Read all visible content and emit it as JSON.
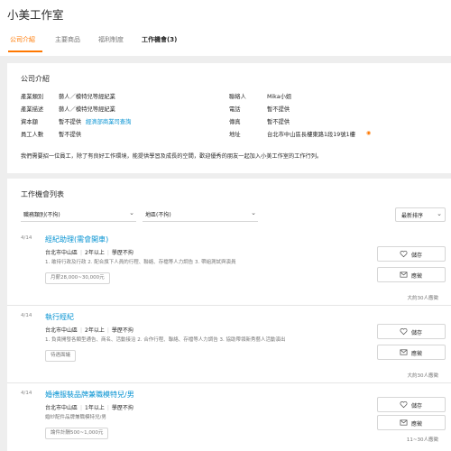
{
  "company": {
    "name": "小美工作室"
  },
  "tabs": [
    {
      "label": "公司介紹"
    },
    {
      "label": "主要商品"
    },
    {
      "label": "福利制度"
    },
    {
      "label": "工作機會(3)"
    }
  ],
  "intro": {
    "title": "公司介紹",
    "fields": {
      "industry_label": "產業類別",
      "industry": "藝人／模特兒等經紀業",
      "industry_desc_label": "產業描述",
      "industry_desc": "藝人／模特兒等經紀業",
      "capital_label": "資本額",
      "capital": "暫不提供",
      "capital_link": "經濟部商業司查詢",
      "employees_label": "員工人數",
      "employees": "暫不提供",
      "contact_label": "聯絡人",
      "contact": "Mika小姐",
      "phone_label": "電話",
      "phone": "暫不提供",
      "fax_label": "傳真",
      "fax": "暫不提供",
      "address_label": "地址",
      "address": "台北市中山區長樓東路1段19號1樓"
    },
    "description": "我們需要招一位員工，除了有良好工作環境，能提供學習及成長的空間，歡迎優秀的朋友一起加入小美工作室的工作行列。"
  },
  "jobs_section": {
    "title": "工作機會列表",
    "filters": {
      "category": "職務類別(不拘)",
      "location": "地區(不拘)"
    },
    "sort": "最新排序"
  },
  "jobs": [
    {
      "date": "4/14",
      "title": "經紀助理(需會開車)",
      "location": "台北市中山區",
      "experience": "2年以上",
      "education": "學歷不拘",
      "description": "1. 敢待行政及行政 2. 配合旗下人員的行程、聯絡、存檔等人力調告 3. 帶組測試與演員",
      "salary": "月薪28,000~30,000元",
      "save_label": "儲存",
      "apply_label": "應徵",
      "applicants": "大約30人應徵"
    },
    {
      "date": "4/14",
      "title": "執行經紀",
      "location": "台北市中山區",
      "experience": "2年以上",
      "education": "學歷不拘",
      "description": "1. 負責開發各類型通告、商名、活動接洽 2. 合作行程、聯絡、存檔等人力調告 3. 協助帶領新秀藝人活動演出",
      "salary": "待遇面議",
      "save_label": "儲存",
      "apply_label": "應徵",
      "applicants": "大約30人應徵"
    },
    {
      "date": "4/14",
      "title": "婚禮服裝品牌兼職模特兒/男",
      "location": "台北市中山區",
      "experience": "1年以上",
      "education": "學歷不拘",
      "description": "婚紗配件品牌兼職模特兒/男",
      "salary": "論件計酬500~1,000元",
      "save_label": "儲存",
      "apply_label": "應徵",
      "applicants": "11~30人應徵"
    }
  ],
  "colors": {
    "accent": "#ff7800",
    "link": "#0492d2",
    "background": "#eeeeee"
  }
}
